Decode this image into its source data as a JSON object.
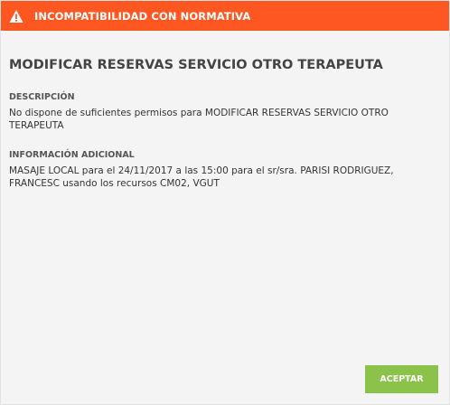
{
  "dialog": {
    "title": "INCOMPATIBILIDAD CON NORMATIVA",
    "heading": "MODIFICAR RESERVAS SERVICIO OTRO TERAPEUTA",
    "description_label": "DESCRIPCIÓN",
    "description_text": "No dispone de suficientes permisos para MODIFICAR RESERVAS SERVICIO OTRO TERAPEUTA",
    "additional_label": "INFORMACIÓN ADICIONAL",
    "additional_text": "MASAJE LOCAL para el 24/11/2017 a las 15:00 para el sr/sra. PARISI RODRIGUEZ, FRANCESC usando los recursos CM02, VGUT",
    "accept_label": "ACEPTAR"
  },
  "colors": {
    "titlebar": "#ff5722",
    "accept_button": "#8bc34a",
    "background": "#f4f4f4"
  },
  "icons": {
    "title_icon": "warning-triangle-icon"
  }
}
